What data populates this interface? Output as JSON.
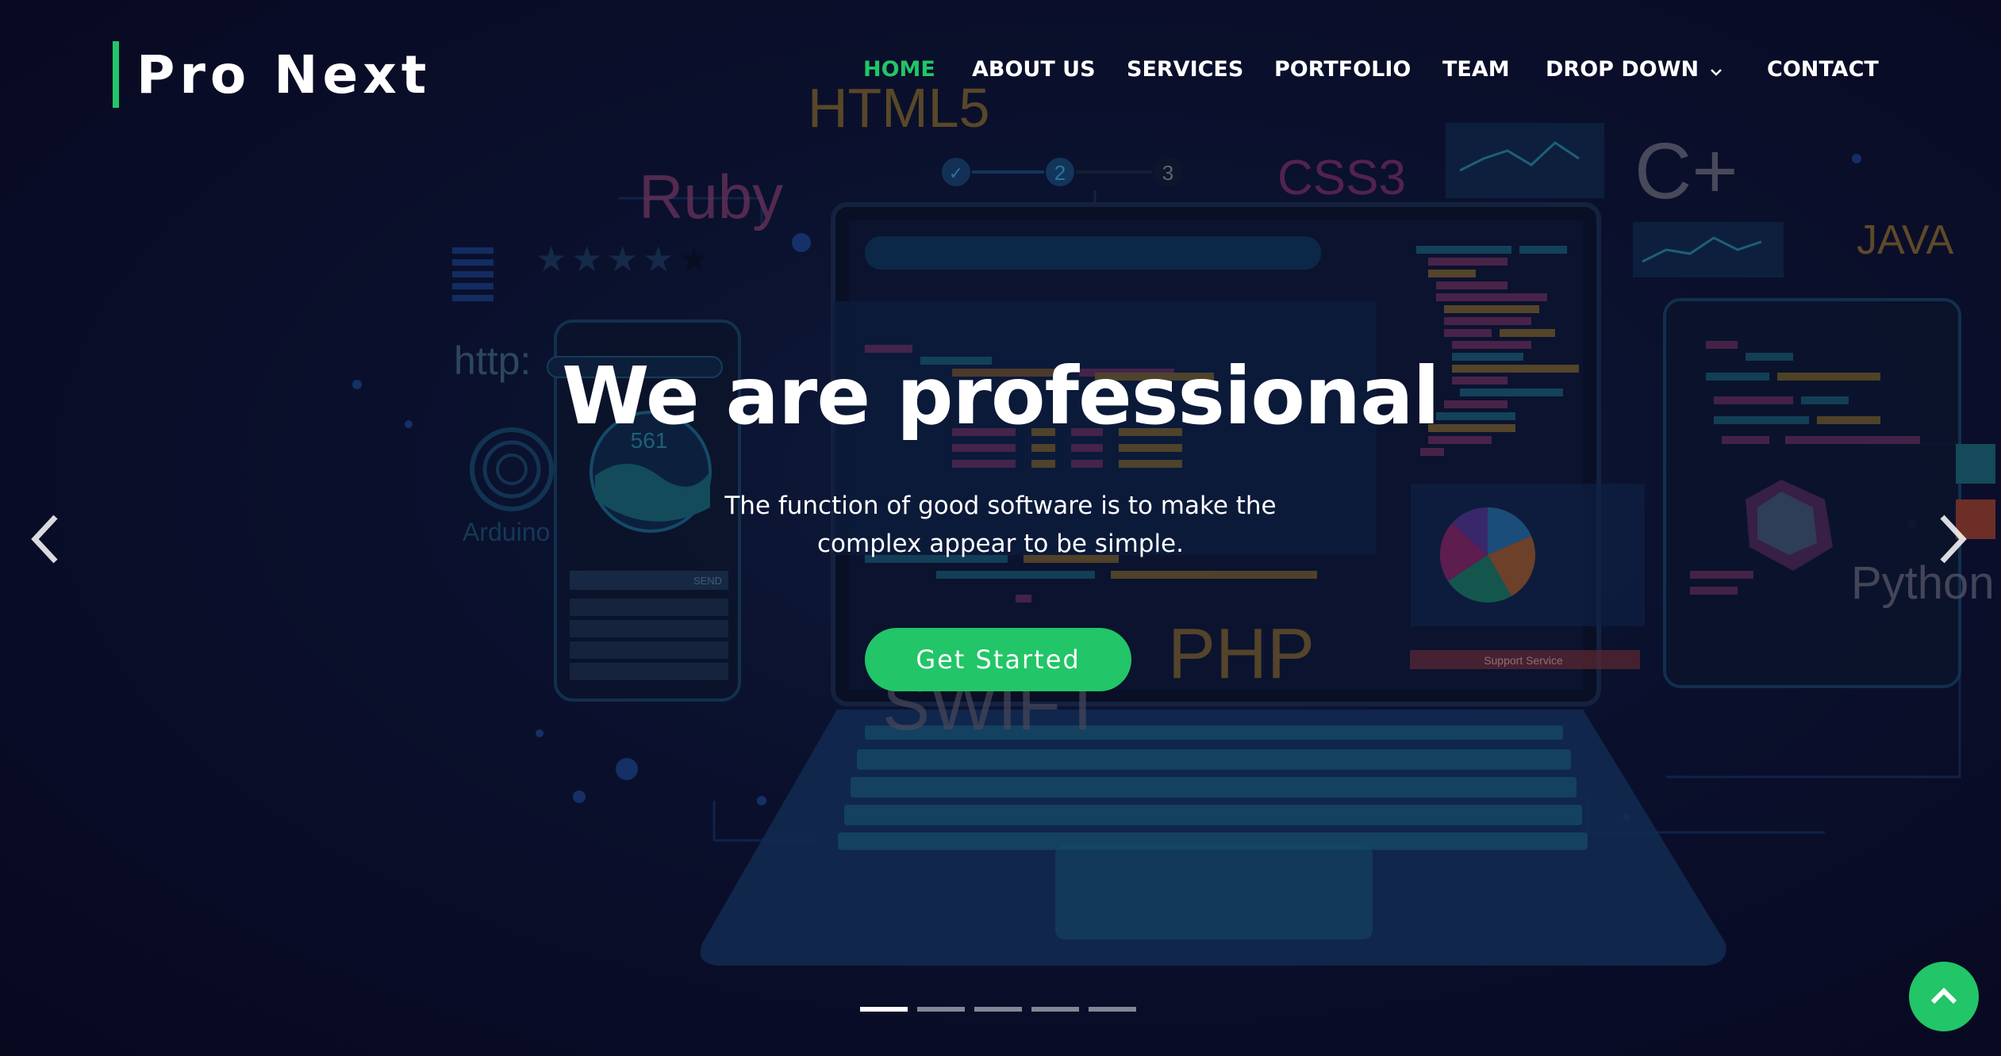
{
  "brand": {
    "name": "Pro Next",
    "accent_color": "#22c567"
  },
  "nav": {
    "items": [
      {
        "label": "HOME",
        "active": true
      },
      {
        "label": "ABOUT US"
      },
      {
        "label": "SERVICES"
      },
      {
        "label": "PORTFOLIO"
      },
      {
        "label": "TEAM"
      },
      {
        "label": "DROP DOWN",
        "icon": "chevron-down-icon"
      },
      {
        "label": "CONTACT"
      }
    ]
  },
  "hero": {
    "title": "We are professional",
    "subtitle_line1": "The function of good software is to make the",
    "subtitle_line2": "complex appear to be simple.",
    "cta_label": "Get Started",
    "background_tags": {
      "html5": "HTML5",
      "ruby": "Ruby",
      "css3": "CSS3",
      "cplus": "C+",
      "java": "JAVA",
      "http": "http:",
      "arduino": "Arduino",
      "python": "Python",
      "php": "PHP",
      "swift": "SWIFT",
      "phone_number": "561",
      "step1": "1",
      "step2": "2",
      "step3": "3",
      "send": "SEND",
      "support": "Support Service"
    }
  },
  "carousel": {
    "slide_count": 5,
    "active_index": 0,
    "prev_icon": "chevron-left-icon",
    "next_icon": "chevron-right-icon"
  },
  "back_to_top": {
    "icon": "chevron-up-icon"
  }
}
